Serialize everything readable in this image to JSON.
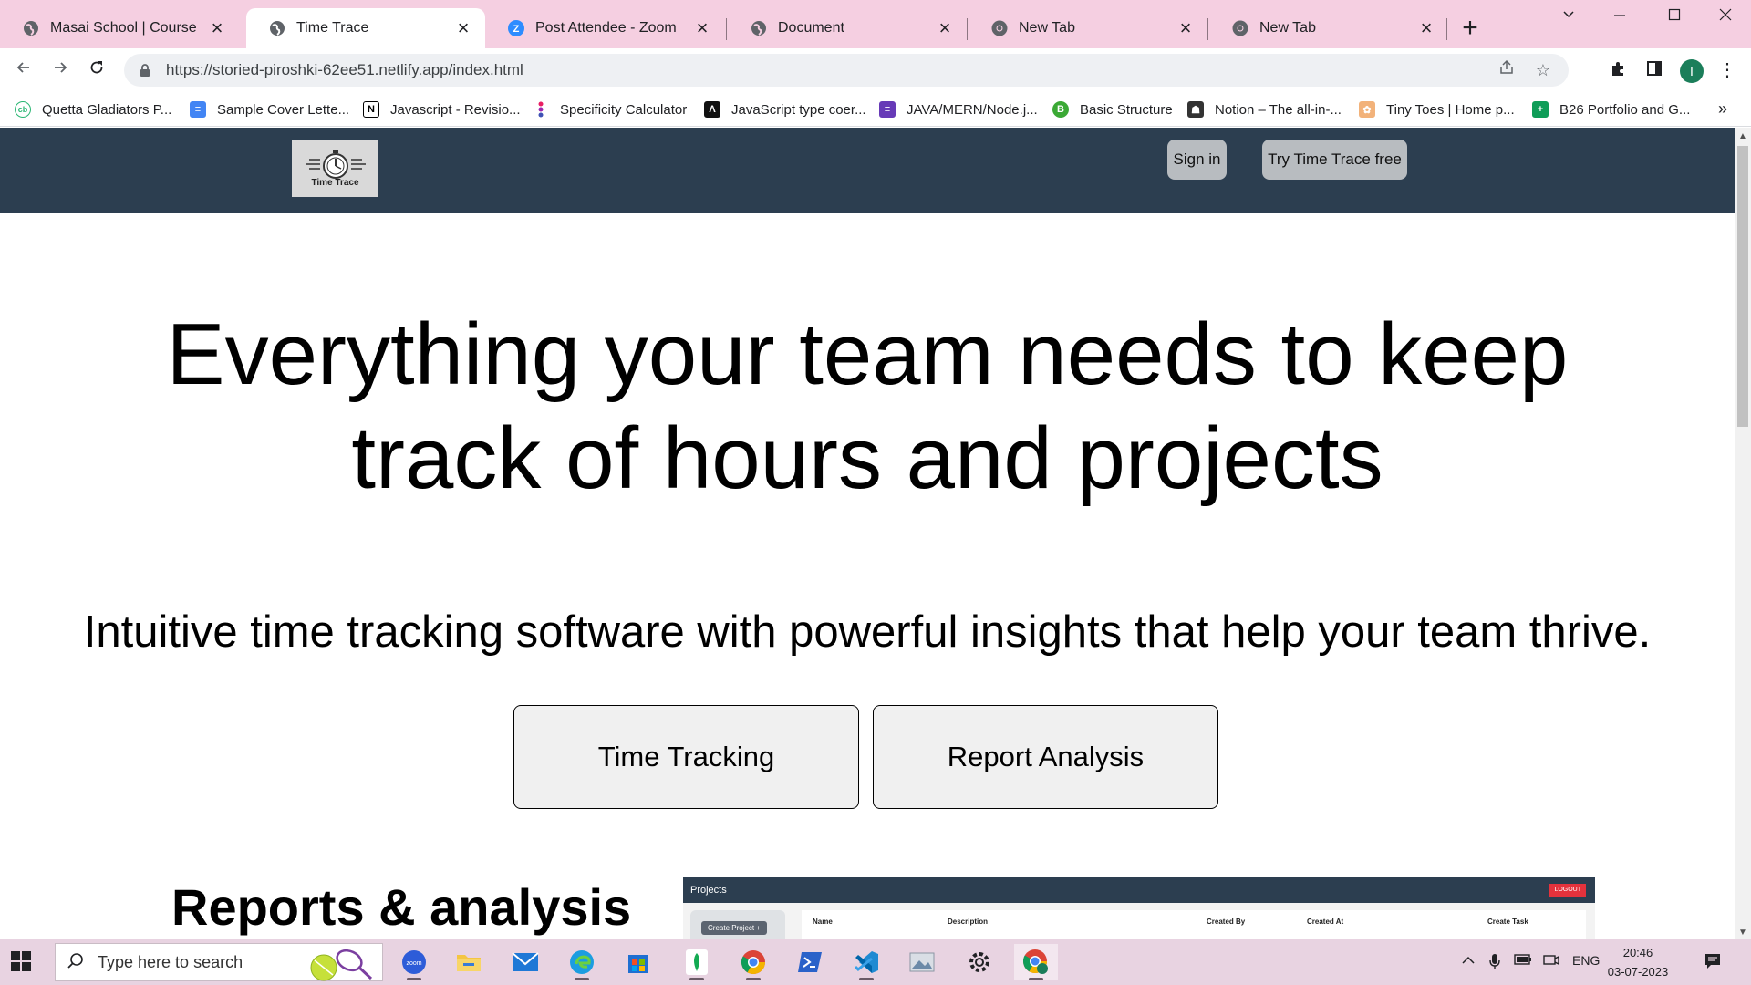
{
  "browser": {
    "tabs": [
      {
        "title": "Masai School | Course",
        "icon": "globe-icon",
        "active": false
      },
      {
        "title": "Time Trace",
        "icon": "globe-icon",
        "active": true
      },
      {
        "title": "Post Attendee - Zoom",
        "icon": "zoom-icon",
        "active": false
      },
      {
        "title": "Document",
        "icon": "globe-icon",
        "active": false
      },
      {
        "title": "New Tab",
        "icon": "chrome-icon",
        "active": false
      },
      {
        "title": "New Tab",
        "icon": "chrome-icon",
        "active": false
      }
    ],
    "url": "https://storied-piroshki-62ee51.netlify.app/index.html",
    "profile_initial": "I",
    "bookmarks": [
      {
        "label": "Quetta Gladiators P...",
        "icon": "cb-icon",
        "color": "#2ab673"
      },
      {
        "label": "Sample Cover Lette...",
        "icon": "docs-icon",
        "color": "#4285f4"
      },
      {
        "label": "Javascript - Revisio...",
        "icon": "notion-icon",
        "color": "#000000"
      },
      {
        "label": "Specificity Calculator",
        "icon": "dots-icon",
        "color": "#9c27b0"
      },
      {
        "label": "JavaScript type coer...",
        "icon": "js-icon",
        "color": "#111111"
      },
      {
        "label": "JAVA/MERN/Node.j...",
        "icon": "forms-icon",
        "color": "#673ab7"
      },
      {
        "label": "Basic Structure",
        "icon": "basic-icon",
        "color": "#3ba935"
      },
      {
        "label": "Notion – The all-in-...",
        "icon": "notion-bm-icon",
        "color": "#333333"
      },
      {
        "label": "Tiny Toes | Home p...",
        "icon": "tinytoes-icon",
        "color": "#f2b27a"
      },
      {
        "label": "B26 Portfolio and G...",
        "icon": "sheets-icon",
        "color": "#0f9d58"
      }
    ]
  },
  "site": {
    "logo_text": "Time Trace",
    "signin_label": "Sign in",
    "try_label": "Try Time Trace free",
    "hero_line1": "Everything your team needs to keep",
    "hero_line2": "track of hours and projects",
    "subtitle": "Intuitive time tracking software with powerful insights that help your team thrive.",
    "cta_time": "Time Tracking",
    "cta_report": "Report Analysis",
    "section_title": "Reports & analysis",
    "preview": {
      "header": "Projects",
      "logout": "LOGOUT",
      "create_button": "Create Project +",
      "columns": [
        "Name",
        "Description",
        "Created By",
        "Created At",
        "Create Task"
      ]
    },
    "nav_color": "#2c3e50"
  },
  "taskbar": {
    "search_placeholder": "Type here to search",
    "tray_lang": "ENG",
    "time": "20:46",
    "date": "03-07-2023",
    "apps": [
      "zoom-icon",
      "file-explorer-icon",
      "mail-icon",
      "edge-icon",
      "store-icon",
      "mongodb-icon",
      "chrome-icon",
      "powershell-icon",
      "vscode-icon",
      "photos-icon",
      "settings-icon",
      "chrome-profile-icon"
    ]
  }
}
